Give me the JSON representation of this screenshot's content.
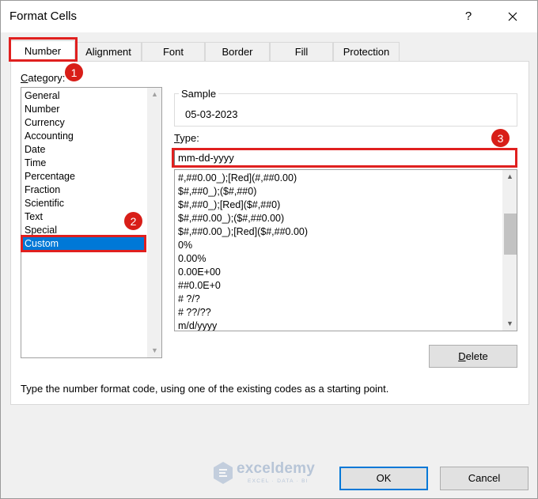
{
  "window": {
    "title": "Format Cells",
    "help_label": "?",
    "close_label": "✕"
  },
  "tabs": [
    {
      "label": "Number",
      "active": true
    },
    {
      "label": "Alignment",
      "active": false
    },
    {
      "label": "Font",
      "active": false
    },
    {
      "label": "Border",
      "active": false
    },
    {
      "label": "Fill",
      "active": false
    },
    {
      "label": "Protection",
      "active": false
    }
  ],
  "category": {
    "label_prefix": "C",
    "label_rest": "ategory:",
    "items": [
      "General",
      "Number",
      "Currency",
      "Accounting",
      "Date",
      "Time",
      "Percentage",
      "Fraction",
      "Scientific",
      "Text",
      "Special",
      "Custom"
    ],
    "selected": "Custom"
  },
  "sample": {
    "title": "Sample",
    "value": "05-03-2023"
  },
  "type": {
    "label_prefix": "T",
    "label_rest": "ype:",
    "value": "mm-dd-yyyy",
    "formats": [
      "#,##0.00_);[Red](#,##0.00)",
      "$#,##0_);($#,##0)",
      "$#,##0_);[Red]($#,##0)",
      "$#,##0.00_);($#,##0.00)",
      "$#,##0.00_);[Red]($#,##0.00)",
      "0%",
      "0.00%",
      "0.00E+00",
      "##0.0E+0",
      "# ?/?",
      "# ??/??",
      "m/d/yyyy"
    ]
  },
  "delete_button": {
    "prefix": "D",
    "rest": "elete"
  },
  "hint": "Type the number format code, using one of the existing codes as a starting point.",
  "footer": {
    "ok_label": "OK",
    "cancel_label": "Cancel"
  },
  "annotations": {
    "badge_1": "1",
    "badge_2": "2",
    "badge_3": "3",
    "annotation_color": "#e0201f"
  },
  "watermark": {
    "name": "exceldemy",
    "tagline": "EXCEL · DATA · BI"
  },
  "colors": {
    "selection": "#0078d7",
    "dialog_bg": "#f0f0f0"
  }
}
